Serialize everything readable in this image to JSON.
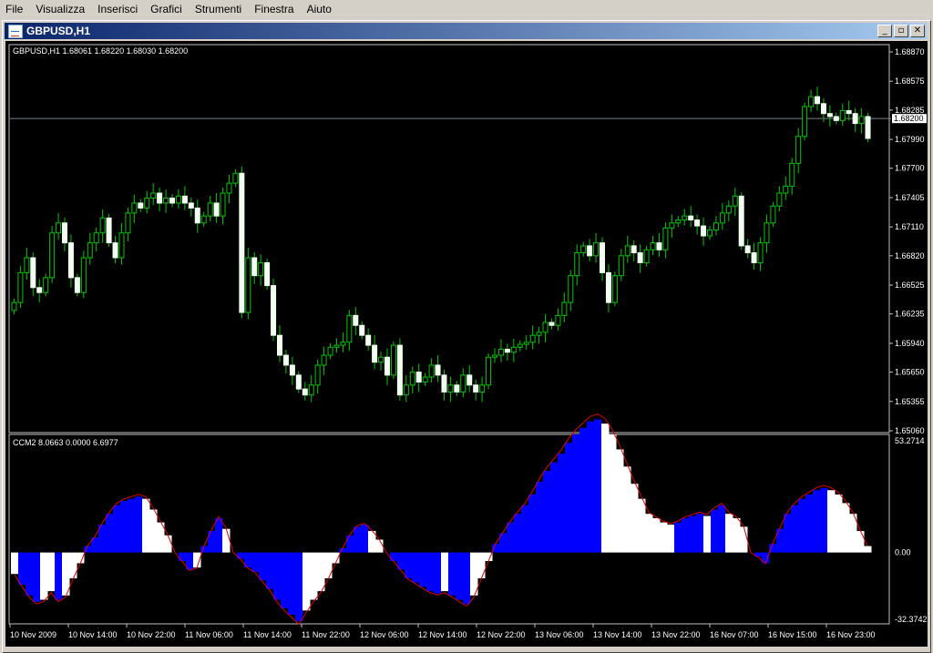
{
  "menu": [
    "File",
    "Visualizza",
    "Inserisci",
    "Grafici",
    "Strumenti",
    "Finestra",
    "Aiuto"
  ],
  "window": {
    "title": "GBPUSD,H1"
  },
  "price_panel": {
    "label": "GBPUSD,H1  1.68061 1.68220 1.68030 1.68200",
    "current_price": "1.68200",
    "axis_labels": [
      "1.68870",
      "1.68575",
      "1.68285",
      "1.67990",
      "1.67700",
      "1.67405",
      "1.67110",
      "1.66820",
      "1.66525",
      "1.66235",
      "1.65940",
      "1.65650",
      "1.65355",
      "1.65060"
    ]
  },
  "indicator_panel": {
    "label": "CCM2 8.0663 0.0000 6.6977",
    "axis_labels": [
      "53.2714",
      "0.00",
      "-32.3742"
    ]
  },
  "time_labels": [
    "10 Nov 2009",
    "10 Nov 14:00",
    "10 Nov 22:00",
    "11 Nov 06:00",
    "11 Nov 14:00",
    "11 Nov 22:00",
    "12 Nov 06:00",
    "12 Nov 14:00",
    "12 Nov 22:00",
    "13 Nov 06:00",
    "13 Nov 14:00",
    "13 Nov 22:00",
    "16 Nov 07:00",
    "16 Nov 15:00",
    "16 Nov 23:00"
  ],
  "chart_data": {
    "type": "candlestick",
    "symbol": "GBPUSD",
    "timeframe": "H1",
    "ylim": [
      1.6506,
      1.6887
    ],
    "current_price": 1.682,
    "closes": [
      1.6635,
      1.6665,
      1.668,
      1.665,
      1.6645,
      1.666,
      1.6705,
      1.6715,
      1.6695,
      1.666,
      1.6645,
      1.668,
      1.6695,
      1.6705,
      1.672,
      1.6695,
      1.668,
      1.6705,
      1.6725,
      1.6735,
      1.673,
      1.674,
      1.6745,
      1.6735,
      1.674,
      1.6735,
      1.6742,
      1.6735,
      1.673,
      1.6715,
      1.6722,
      1.6735,
      1.6722,
      1.6745,
      1.6755,
      1.6765,
      1.6625,
      1.668,
      1.6662,
      1.6675,
      1.6652,
      1.6602,
      1.6582,
      1.6572,
      1.6562,
      1.6548,
      1.6542,
      1.6552,
      1.6572,
      1.6582,
      1.659,
      1.6592,
      1.6595,
      1.6622,
      1.6612,
      1.6602,
      1.6592,
      1.6575,
      1.658,
      1.6562,
      1.6592,
      1.6542,
      1.6552,
      1.6565,
      1.6555,
      1.656,
      1.6572,
      1.6562,
      1.6545,
      1.6552,
      1.6545,
      1.6562,
      1.6552,
      1.6545,
      1.6552,
      1.658,
      1.6582,
      1.6588,
      1.6585,
      1.659,
      1.6593,
      1.6595,
      1.6602,
      1.6605,
      1.6615,
      1.6612,
      1.6622,
      1.6635,
      1.6662,
      1.6685,
      1.6692,
      1.6682,
      1.6695,
      1.6665,
      1.6635,
      1.6662,
      1.6682,
      1.6692,
      1.6685,
      1.6675,
      1.6688,
      1.6695,
      1.6688,
      1.671,
      1.6715,
      1.6718,
      1.6722,
      1.6718,
      1.6712,
      1.6702,
      1.6708,
      1.6715,
      1.6725,
      1.6732,
      1.6742,
      1.6692,
      1.6685,
      1.6675,
      1.6695,
      1.6715,
      1.6732,
      1.6745,
      1.6752,
      1.6775,
      1.6802,
      1.6832,
      1.6842,
      1.6835,
      1.6825,
      1.6822,
      1.6818,
      1.6828,
      1.6825,
      1.6815,
      1.6822,
      1.68
    ]
  },
  "indicator_data": {
    "name": "CCM2",
    "values": [
      8.0663,
      0.0,
      6.6977
    ],
    "ylim": [
      -32.3742,
      53.2714
    ],
    "series": [
      -10,
      -15,
      -20,
      -23,
      -22,
      -18,
      -22,
      -20,
      -12,
      -5,
      3,
      7,
      13,
      18,
      22,
      24,
      25,
      26,
      25,
      20,
      14,
      8,
      0,
      -4,
      -8,
      -7,
      3,
      10,
      16,
      11,
      0,
      -3,
      -7,
      -9,
      -13,
      -17,
      -22,
      -26,
      -29,
      -32,
      -27,
      -22,
      -18,
      -12,
      -5,
      2,
      8,
      12,
      13,
      10,
      6,
      0,
      -4,
      -8,
      -12,
      -14,
      -16,
      -18,
      -19,
      -18,
      -20,
      -22,
      -24,
      -20,
      -12,
      -4,
      4,
      9,
      14,
      18,
      22,
      27,
      33,
      38,
      42,
      46,
      51,
      55,
      58,
      61,
      62,
      60,
      55,
      48,
      40,
      32,
      25,
      18,
      16,
      14,
      13,
      14,
      16,
      17,
      18,
      17,
      20,
      22,
      18,
      16,
      12,
      0,
      -2,
      -5,
      4,
      11,
      18,
      22,
      25,
      27,
      29,
      30,
      29,
      27,
      23,
      18,
      10,
      3
    ]
  }
}
